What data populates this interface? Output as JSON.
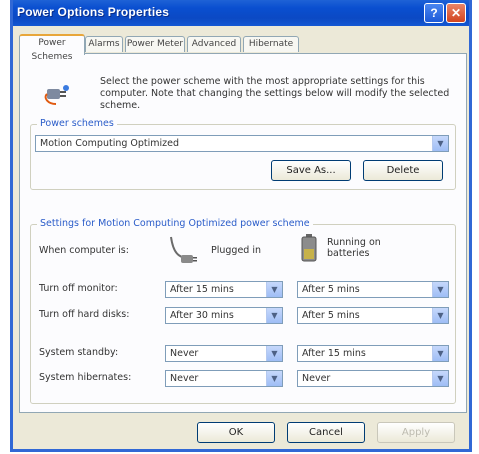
{
  "window": {
    "title": "Power Options Properties",
    "help_label": "?",
    "close_label": "✕"
  },
  "tabs": [
    {
      "label": "Power Schemes",
      "active": true
    },
    {
      "label": "Alarms"
    },
    {
      "label": "Power Meter"
    },
    {
      "label": "Advanced"
    },
    {
      "label": "Hibernate"
    }
  ],
  "description": "Select the power scheme with the most appropriate settings for this computer. Note that changing the settings below will modify the selected scheme.",
  "power_schemes": {
    "group_title": "Power schemes",
    "selected": "Motion Computing Optimized",
    "save_as_label": "Save As...",
    "delete_label": "Delete"
  },
  "settings": {
    "group_title": "Settings for Motion Computing Optimized power scheme",
    "when_label": "When computer is:",
    "plugged_in_label": "Plugged in",
    "batteries_label": "Running on batteries",
    "rows": [
      {
        "label": "Turn off monitor:",
        "plugged": "After 15 mins",
        "battery": "After 5 mins"
      },
      {
        "label": "Turn off hard disks:",
        "plugged": "After 30 mins",
        "battery": "After 5 mins"
      },
      {
        "label": "System standby:",
        "plugged": "Never",
        "battery": "After 15 mins"
      },
      {
        "label": "System hibernates:",
        "plugged": "Never",
        "battery": "Never"
      }
    ]
  },
  "buttons": {
    "ok": "OK",
    "cancel": "Cancel",
    "apply": "Apply"
  },
  "colors": {
    "titlebar": "#0b49c4",
    "accent_tab": "#e8a63a",
    "group_title": "#2a5cc9"
  }
}
